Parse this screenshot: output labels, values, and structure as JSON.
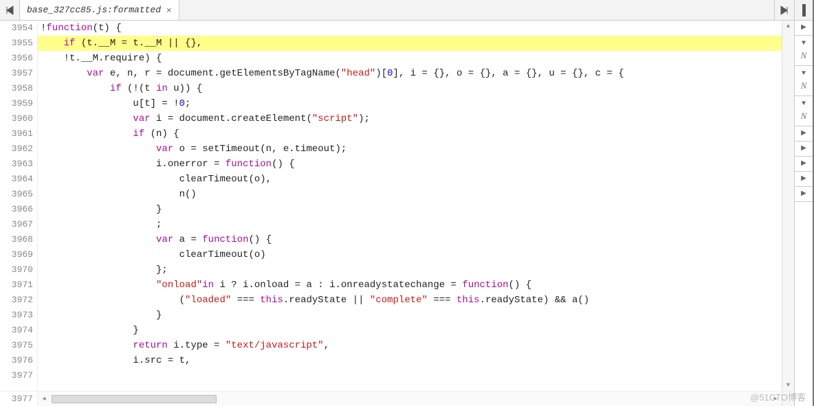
{
  "tab": {
    "filename": "base_327cc85.js:formatted",
    "close": "×"
  },
  "gutter": {
    "start": 3954,
    "count": 24
  },
  "highlight_line": 3955,
  "code_lines": [
    {
      "n": 3954,
      "seg": [
        [
          "",
          "!"
        ],
        [
          "kw",
          "function"
        ],
        [
          "",
          "(t) {"
        ]
      ]
    },
    {
      "n": 3955,
      "seg": [
        [
          "",
          "    "
        ],
        [
          "kw",
          "if"
        ],
        [
          "",
          " (t.__M = t.__M || {},"
        ]
      ]
    },
    {
      "n": 3956,
      "seg": [
        [
          "",
          "    !t.__M.require) {"
        ]
      ]
    },
    {
      "n": 3957,
      "seg": [
        [
          "",
          "        "
        ],
        [
          "kw",
          "var"
        ],
        [
          "",
          " e, n, r = document.getElementsByTagName("
        ],
        [
          "str",
          "\"head\""
        ],
        [
          "",
          ")["
        ],
        [
          "num",
          "0"
        ],
        [
          "",
          "], i = {}, o = {}, a = {}, u = {}, c = {"
        ]
      ]
    },
    {
      "n": 3958,
      "seg": [
        [
          "",
          "            "
        ],
        [
          "kw",
          "if"
        ],
        [
          "",
          " (!(t "
        ],
        [
          "kw",
          "in"
        ],
        [
          "",
          " u)) {"
        ]
      ]
    },
    {
      "n": 3959,
      "seg": [
        [
          "",
          "                u[t] = !"
        ],
        [
          "num",
          "0"
        ],
        [
          "",
          ";"
        ]
      ]
    },
    {
      "n": 3960,
      "seg": [
        [
          "",
          "                "
        ],
        [
          "kw",
          "var"
        ],
        [
          "",
          " i = document.createElement("
        ],
        [
          "str",
          "\"script\""
        ],
        [
          "",
          ");"
        ]
      ]
    },
    {
      "n": 3961,
      "seg": [
        [
          "",
          "                "
        ],
        [
          "kw",
          "if"
        ],
        [
          "",
          " (n) {"
        ]
      ]
    },
    {
      "n": 3962,
      "seg": [
        [
          "",
          "                    "
        ],
        [
          "kw",
          "var"
        ],
        [
          "",
          " o = setTimeout(n, e.timeout);"
        ]
      ]
    },
    {
      "n": 3963,
      "seg": [
        [
          "",
          "                    i.onerror = "
        ],
        [
          "kw",
          "function"
        ],
        [
          "",
          "() {"
        ]
      ]
    },
    {
      "n": 3964,
      "seg": [
        [
          "",
          "                        clearTimeout(o),"
        ]
      ]
    },
    {
      "n": 3965,
      "seg": [
        [
          "",
          "                        n()"
        ]
      ]
    },
    {
      "n": 3966,
      "seg": [
        [
          "",
          "                    }"
        ]
      ]
    },
    {
      "n": 3967,
      "seg": [
        [
          "",
          "                    ;"
        ]
      ]
    },
    {
      "n": 3968,
      "seg": [
        [
          "",
          "                    "
        ],
        [
          "kw",
          "var"
        ],
        [
          "",
          " a = "
        ],
        [
          "kw",
          "function"
        ],
        [
          "",
          "() {"
        ]
      ]
    },
    {
      "n": 3969,
      "seg": [
        [
          "",
          "                        clearTimeout(o)"
        ]
      ]
    },
    {
      "n": 3970,
      "seg": [
        [
          "",
          "                    };"
        ]
      ]
    },
    {
      "n": 3971,
      "seg": [
        [
          "",
          "                    "
        ],
        [
          "str",
          "\"onload\""
        ],
        [
          "kw",
          "in"
        ],
        [
          "",
          " i ? i.onload = a : i.onreadystatechange = "
        ],
        [
          "kw",
          "function"
        ],
        [
          "",
          "() {"
        ]
      ]
    },
    {
      "n": 3972,
      "seg": [
        [
          "",
          "                        ("
        ],
        [
          "str",
          "\"loaded\""
        ],
        [
          "",
          " === "
        ],
        [
          "kw",
          "this"
        ],
        [
          "",
          ".readyState || "
        ],
        [
          "str",
          "\"complete\""
        ],
        [
          "",
          " === "
        ],
        [
          "kw",
          "this"
        ],
        [
          "",
          ".readyState) && a()"
        ]
      ]
    },
    {
      "n": 3973,
      "seg": [
        [
          "",
          "                    }"
        ]
      ]
    },
    {
      "n": 3974,
      "seg": [
        [
          "",
          "                }"
        ]
      ]
    },
    {
      "n": 3975,
      "seg": [
        [
          "",
          "                "
        ],
        [
          "kw",
          "return"
        ],
        [
          "",
          " i.type = "
        ],
        [
          "str",
          "\"text/javascript\""
        ],
        [
          "",
          ","
        ]
      ]
    },
    {
      "n": 3976,
      "seg": [
        [
          "",
          "                i.src = t,"
        ]
      ]
    }
  ],
  "hscroll_last_line": "3977",
  "right_items": [
    {
      "dir": "right",
      "n": false
    },
    {
      "dir": "down",
      "n": true
    },
    {
      "dir": "down",
      "n": true
    },
    {
      "dir": "down",
      "n": true
    },
    {
      "dir": "right",
      "n": false
    },
    {
      "dir": "right",
      "n": false
    },
    {
      "dir": "right",
      "n": false
    },
    {
      "dir": "right",
      "n": false
    },
    {
      "dir": "right",
      "n": false
    }
  ],
  "n_label": "N",
  "watermark": "@51CTO博客"
}
